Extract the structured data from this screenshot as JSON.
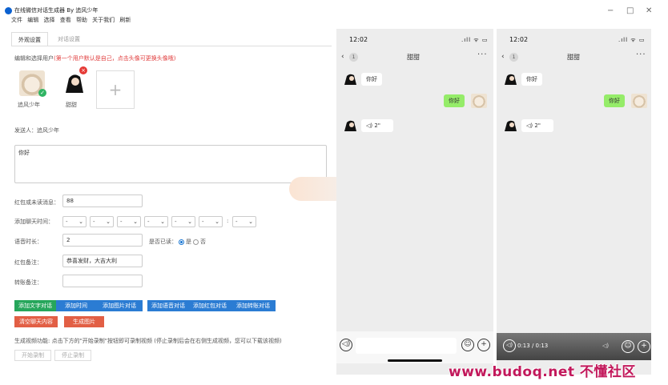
{
  "window": {
    "title": "在线微信对话生成器 By 追风少年",
    "menu": [
      "文件",
      "编辑",
      "选择",
      "查看",
      "帮助",
      "关于我们",
      "刷新"
    ],
    "controls": {
      "minimize": "−",
      "maximize": "□",
      "close": "✕"
    }
  },
  "tabs": [
    {
      "label": "外观设置",
      "active": true
    },
    {
      "label": "对话设置",
      "active": false
    }
  ],
  "users": {
    "hint": "编辑和选择用户",
    "hint_red": "(第一个用户默认是自己，点击头像可更换头像哦)",
    "list": [
      {
        "name": "追风少年"
      },
      {
        "name": "甜甜"
      }
    ],
    "add": "+"
  },
  "sender": {
    "label": "发送人：",
    "name": "追风少年"
  },
  "message": {
    "value": "你好"
  },
  "fields": {
    "unread_label": "红包或未读消息：",
    "unread_value": "88",
    "time_label": "添加聊天时间：",
    "time_selects": [
      "-",
      "-",
      "-",
      "-",
      "-",
      "-",
      "-"
    ],
    "time_colon": ":",
    "voice_label": "语音时长：",
    "voice_value": "2",
    "read_label": "是否已读：",
    "read_yes": "是",
    "read_no": "否",
    "redpacket_label": "红包备注：",
    "redpacket_value": "恭喜发财，大吉大利",
    "transfer_label": "转账备注：",
    "transfer_value": ""
  },
  "buttons": {
    "row1": [
      "添加文字对话",
      "添加时间",
      "添加图片对话",
      "添加语音对话",
      "添加红包对话",
      "添加转账对话"
    ],
    "clear": "清空聊天内容",
    "generate": "生成图片"
  },
  "video_hint": "生成视频功能: 点击下方的\"开始录制\"按钮即可录制视频 (停止录制后会在右侧生成视频，您可以下载该视频)",
  "record": {
    "start": "开始录制",
    "stop": "停止录制"
  },
  "phone": {
    "time": "12:02",
    "status": ".ıll ᯤ ▭",
    "back": "‹",
    "unread": "1",
    "contact": "甜甜",
    "more": "···",
    "messages": [
      {
        "side": "left",
        "text": "你好"
      },
      {
        "side": "right",
        "text": "你好"
      },
      {
        "side": "left",
        "voice": "◁) 2\""
      }
    ],
    "voice_icon": "◁)",
    "emoji": "☺",
    "plus": "+"
  },
  "video": {
    "time": "0:13 / 0:13",
    "play": "◁)",
    "vol": "◁)"
  },
  "watermark": "www.budoq.net 不懂社区"
}
